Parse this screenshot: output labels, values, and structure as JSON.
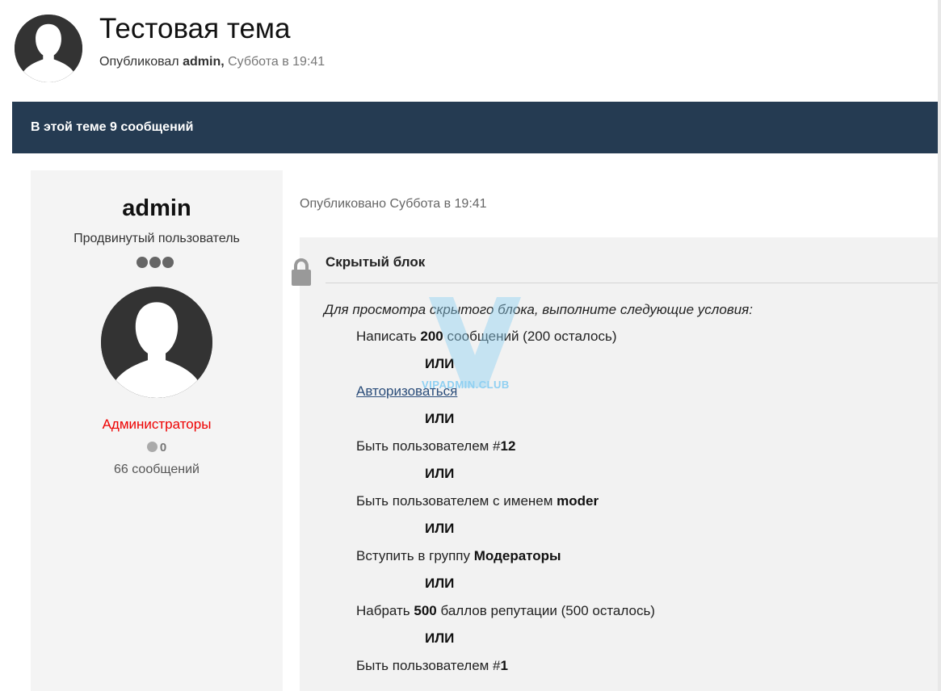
{
  "topic": {
    "title": "Тестовая тема",
    "byline_prefix": "Опубликовал",
    "author": "admin,",
    "date": "Суббота в 19:41",
    "avatar_icon": "user-silhouette-icon"
  },
  "bar": {
    "text": "В этой теме 9 сообщений"
  },
  "post": {
    "author": {
      "name": "admin",
      "rank": "Продвинутый пользователь",
      "rank_dots": 3,
      "avatar_icon": "user-silhouette-icon",
      "group": "Администраторы",
      "group_color": "#ee0000",
      "reputation": "0",
      "posts": "66 сообщений"
    },
    "published": "Опубликовано Суббота в 19:41",
    "hidden_block": {
      "icon": "lock-icon",
      "title": "Скрытый блок",
      "intro": "Для просмотра скрытого блока, выполните следующие условия:",
      "or_label": "ИЛИ",
      "conditions": [
        {
          "pre": "Написать ",
          "bold": "200",
          "post": " сообщений (200 осталось)"
        },
        {
          "link": "Авторизоваться"
        },
        {
          "pre": "Быть пользователем #",
          "bold": "12",
          "post": ""
        },
        {
          "pre": "Быть пользователем с именем ",
          "bold": "moder",
          "post": ""
        },
        {
          "pre": "Вступить в группу ",
          "bold": "Модераторы",
          "post": ""
        },
        {
          "pre": "Набрать ",
          "bold": "500",
          "post": " баллов репутации (500 осталось)"
        },
        {
          "pre": "Быть пользователем #",
          "bold": "1",
          "post": ""
        }
      ]
    }
  },
  "watermark": {
    "text": "VIPADMIN.CLUB",
    "color": "#8fd0f2"
  },
  "colors": {
    "bar_bg": "#253b52",
    "link": "#2b4d7a"
  }
}
